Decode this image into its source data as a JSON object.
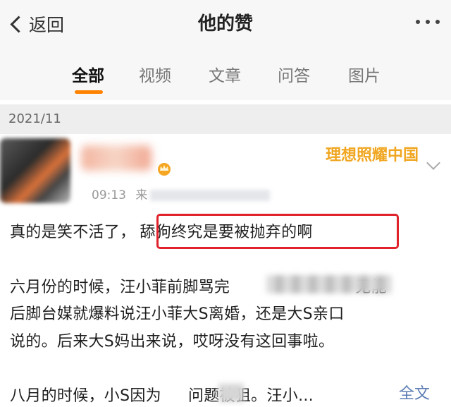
{
  "nav": {
    "back_label": "返回",
    "title": "他的赞"
  },
  "tabs": [
    {
      "label": "全部",
      "active": true
    },
    {
      "label": "视频",
      "active": false
    },
    {
      "label": "文章",
      "active": false
    },
    {
      "label": "问答",
      "active": false
    },
    {
      "label": "图片",
      "active": false
    }
  ],
  "date_header": "2021/11",
  "post": {
    "meta_time": "09:13",
    "meta_source_prefix": "来",
    "watermark": "理想照耀中国",
    "lines": {
      "l1_prefix": "真的是笑不活了，",
      "l1_highlight": "舔狗终究是要被抛弃的啊",
      "l2_part1": "六月份的时候，汪小菲前脚骂完",
      "l2_part2": "无能",
      "l3": "后脚台媒就爆料说汪小菲大S离婚，还是大S亲口",
      "l4": "说的。后来大S妈出来说，哎呀没有这回事啦。",
      "l5_part1": "八月的时候，小S因为",
      "l5_part2": "问题被狙。汪小...",
      "full_text_link": "全文"
    }
  },
  "colors": {
    "accent_orange": "#ff8200",
    "highlight_red": "#e0222a",
    "link_blue": "#5b7db3",
    "watermark_gold": "#f0a620"
  }
}
